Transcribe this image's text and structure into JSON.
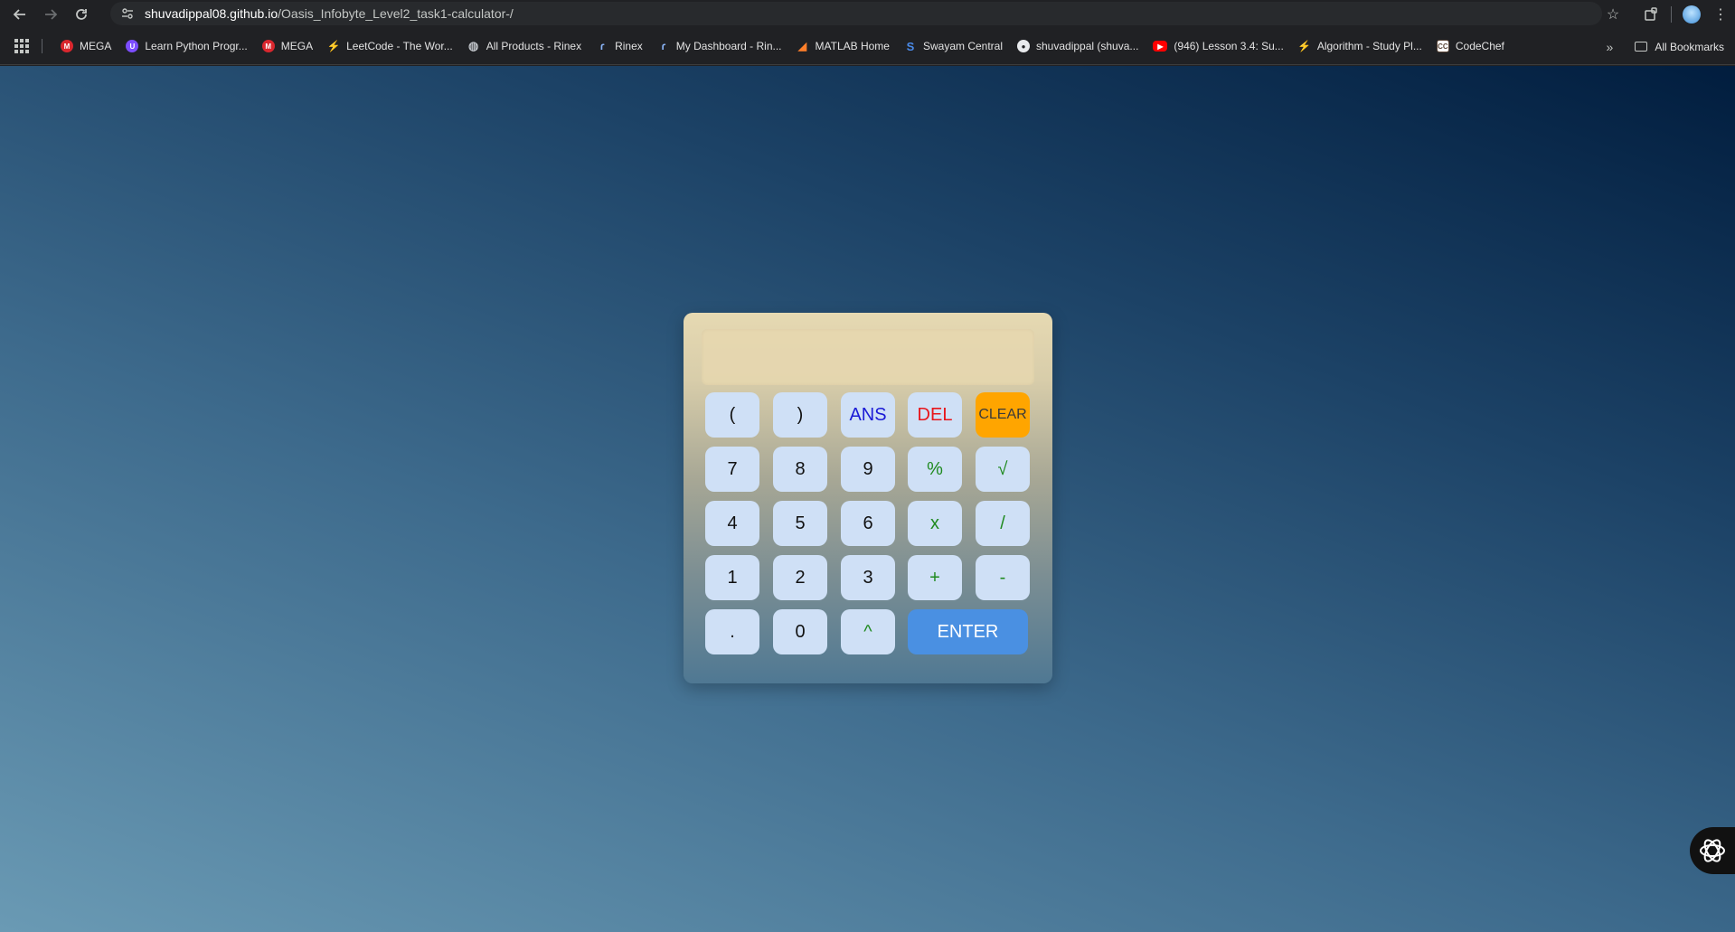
{
  "browser": {
    "url_host": "shuvadippal08.github.io",
    "url_path": "/Oasis_Infobyte_Level2_task1-calculator-/",
    "bookmarks": [
      {
        "label": "MEGA",
        "icon": "mega-icon",
        "glyph": "M"
      },
      {
        "label": "Learn Python Progr...",
        "icon": "python-course-icon",
        "glyph": "U"
      },
      {
        "label": "MEGA",
        "icon": "mega-icon",
        "glyph": "M"
      },
      {
        "label": "LeetCode - The Wor...",
        "icon": "leetcode-icon",
        "glyph": "⚡"
      },
      {
        "label": "All Products - Rinex",
        "icon": "globe-icon",
        "glyph": "🌐"
      },
      {
        "label": "Rinex",
        "icon": "rinex-icon",
        "glyph": "ɾ"
      },
      {
        "label": "My Dashboard - Rin...",
        "icon": "rinex-icon",
        "glyph": "ɾ"
      },
      {
        "label": "MATLAB Home",
        "icon": "matlab-icon",
        "glyph": "◢"
      },
      {
        "label": "Swayam Central",
        "icon": "swayam-icon",
        "glyph": "S"
      },
      {
        "label": "shuvadippal (shuva...",
        "icon": "github-icon",
        "glyph": "●"
      },
      {
        "label": "(946) Lesson 3.4: Su...",
        "icon": "youtube-icon",
        "glyph": "▶"
      },
      {
        "label": "Algorithm - Study Pl...",
        "icon": "leetcode-icon",
        "glyph": "⚡"
      },
      {
        "label": "CodeChef",
        "icon": "codechef-icon",
        "glyph": "CC"
      }
    ],
    "all_bookmarks_label": "All Bookmarks"
  },
  "calculator": {
    "display_value": "",
    "keys": {
      "lparen": "(",
      "rparen": ")",
      "ans": "ANS",
      "del": "DEL",
      "clear": "CLEAR",
      "k7": "7",
      "k8": "8",
      "k9": "9",
      "percent": "%",
      "sqrt": "√",
      "k4": "4",
      "k5": "5",
      "k6": "6",
      "multiply": "x",
      "divide": "/",
      "k1": "1",
      "k2": "2",
      "k3": "3",
      "plus": "+",
      "minus": "-",
      "dot": ".",
      "k0": "0",
      "power": "^",
      "enter": "ENTER"
    },
    "colors": {
      "key_bg": "#cfe0f6",
      "operator": "#1f8a1f",
      "ans": "#1b1bd6",
      "del": "#e8161b",
      "clear_bg": "#ffa500",
      "enter_bg": "#4a90e2"
    }
  }
}
